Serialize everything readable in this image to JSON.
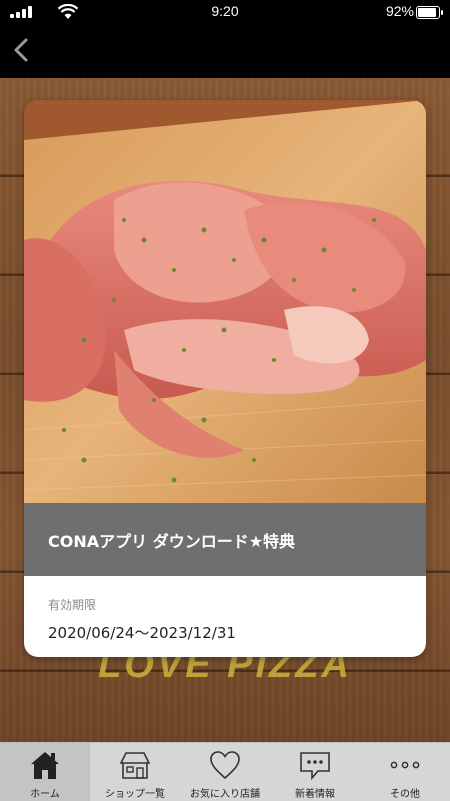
{
  "status_bar": {
    "time": "9:20",
    "battery_percent": "92%",
    "battery_level": 0.92
  },
  "coupon": {
    "title": "CONAアプリ ダウンロード★特典",
    "expiry_label": "有効期限",
    "expiry_value": "2020/06/24〜2023/12/31"
  },
  "background_text": "LOVE PIZZA",
  "tabs": [
    {
      "label": "ホーム",
      "icon": "home-icon",
      "active": true
    },
    {
      "label": "ショップ一覧",
      "icon": "shop-icon",
      "active": false
    },
    {
      "label": "お気に入り店舗",
      "icon": "heart-icon",
      "active": false
    },
    {
      "label": "新着情報",
      "icon": "message-icon",
      "active": false
    },
    {
      "label": "その他",
      "icon": "more-icon",
      "active": false
    }
  ],
  "colors": {
    "caption_bar": "#6f6f6f",
    "tab_bar": "#d6d6d6",
    "accent_text": "#c9b43c"
  }
}
